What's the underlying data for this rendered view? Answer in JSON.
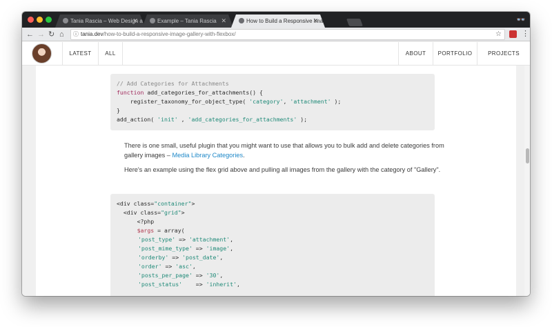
{
  "browser": {
    "tabs": [
      {
        "title": "Tania Rascia – Web Design and",
        "active": false
      },
      {
        "title": "Example – Tania Rascia",
        "active": false
      },
      {
        "title": "How to Build a Responsive Ima",
        "active": true
      }
    ],
    "url_domain": "tania.dev",
    "url_path": "/how-to-build-a-responsive-image-gallery-with-flexbox/",
    "traffic_colors": [
      "#fc5f57",
      "#fdbc2e",
      "#29c841"
    ]
  },
  "site_nav": {
    "left": [
      "LATEST",
      "ALL"
    ],
    "right": [
      "ABOUT",
      "PORTFOLIO",
      "PROJECTS"
    ]
  },
  "code_block_1": {
    "comment": "// Add Categories for Attachments",
    "keyword_function": "function",
    "function_name": " add_categories_for_attachments() {",
    "line2_prefix": "    register_taxonomy_for_object_type( ",
    "line2_arg1": "'category'",
    "line2_sep": ", ",
    "line2_arg2": "'attachment'",
    "line2_suffix": " );",
    "line3": "}",
    "line4_prefix": "add_action( ",
    "line4_arg1": "'init'",
    "line4_sep": " , ",
    "line4_arg2": "'add_categories_for_attachments'",
    "line4_suffix": " );"
  },
  "paragraph_1": {
    "text": "There is one small, useful plugin that you might want to use that allows you to bulk add and delete categories from gallery images – ",
    "link": "Media Library Categories",
    "end": "."
  },
  "paragraph_2": {
    "text": "Here's an example using the flex grid above and pulling all images from the gallery with the category of \"Gallery\"."
  },
  "code_block_2": {
    "l1_a": "<div class=",
    "l1_b": "\"container\"",
    "l1_c": ">",
    "l2_a": "  <div class=",
    "l2_b": "\"grid\"",
    "l2_c": ">",
    "l3": "      <?php",
    "l4_var": "      $args",
    "l4_rest": " = array(",
    "rows": [
      {
        "key": "'post_type'",
        "sep": " => ",
        "val": "'attachment'",
        "end": ","
      },
      {
        "key": "'post_mime_type'",
        "sep": " => ",
        "val": "'image'",
        "end": ","
      },
      {
        "key": "'orderby'",
        "sep": " => ",
        "val": "'post_date'",
        "end": ","
      },
      {
        "key": "'order'",
        "sep": " => ",
        "val": "'asc'",
        "end": ","
      },
      {
        "key": "'posts_per_page'",
        "sep": " => ",
        "val": "'30'",
        "end": ","
      },
      {
        "key": "'post_status'",
        "sep": "    => ",
        "val": "'inherit'",
        "end": ","
      }
    ]
  }
}
